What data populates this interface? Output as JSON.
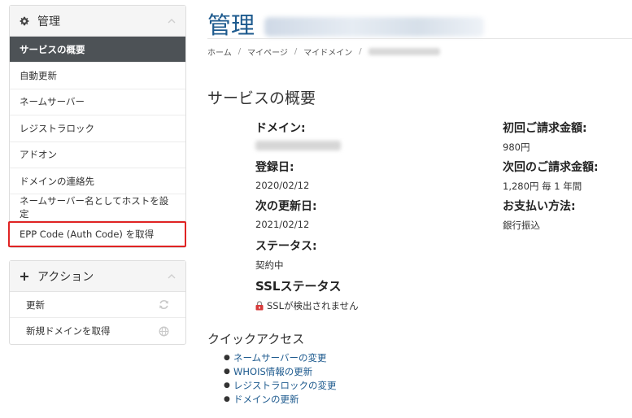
{
  "sidebar": {
    "manage_title": "管理",
    "items": [
      {
        "label": "サービスの概要",
        "active": true
      },
      {
        "label": "自動更新"
      },
      {
        "label": "ネームサーバー"
      },
      {
        "label": "レジストラロック"
      },
      {
        "label": "アドオン"
      },
      {
        "label": "ドメインの連絡先"
      },
      {
        "label": "ネームサーバー名としてホストを設定"
      },
      {
        "label": "EPP Code (Auth Code) を取得",
        "highlighted": true
      }
    ],
    "actions_title": "アクション",
    "actions": [
      {
        "label": "更新",
        "icon": "refresh-icon"
      },
      {
        "label": "新規ドメインを取得",
        "icon": "globe-icon"
      }
    ]
  },
  "header": {
    "title": "管理",
    "breadcrumb": [
      "ホーム",
      "マイページ",
      "マイドメイン"
    ]
  },
  "overview": {
    "title": "サービスの概要",
    "domain_label": "ドメイン:",
    "registered_label": "登録日:",
    "registered_value": "2020/02/12",
    "next_renewal_label": "次の更新日:",
    "next_renewal_value": "2021/02/12",
    "status_label": "ステータス:",
    "status_value": "契約中",
    "ssl_label": "SSLステータス",
    "ssl_value": "SSLが検出されません",
    "first_amount_label": "初回ご請求金額:",
    "first_amount_value": "980円",
    "next_amount_label": "次回のご請求金額:",
    "next_amount_value": "1,280円 毎 1 年間",
    "payment_label": "お支払い方法:",
    "payment_value": "銀行振込"
  },
  "quick_access": {
    "title": "クイックアクセス",
    "links": [
      "ネームサーバーの変更",
      "WHOIS情報の更新",
      "レジストラロックの変更",
      "ドメインの更新"
    ]
  },
  "colors": {
    "accent": "#1d5a8e",
    "active_bg": "#4d5256",
    "highlight": "#e02424"
  }
}
